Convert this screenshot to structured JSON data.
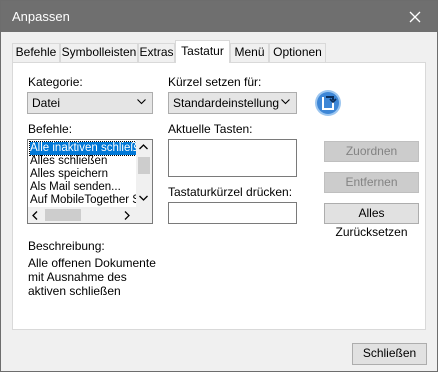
{
  "window": {
    "title": "Anpassen"
  },
  "tabs": [
    {
      "label": "Befehle"
    },
    {
      "label": "Symbolleisten"
    },
    {
      "label": "Extras"
    },
    {
      "label": "Tastatur"
    },
    {
      "label": "Menü"
    },
    {
      "label": "Optionen"
    }
  ],
  "active_tab": "Tastatur",
  "category": {
    "label": "Kategorie:",
    "value": "Datei"
  },
  "shortcut_for": {
    "label": "Kürzel setzen für:",
    "value": "Standardeinstellung"
  },
  "commands": {
    "label": "Befehle:",
    "items": [
      "Alle inaktiven schließen",
      "Alles schließen",
      "Alles speichern",
      "Als Mail senden...",
      "Auf MobileTogether Server"
    ],
    "selected_index": 0
  },
  "current_keys": {
    "label": "Aktuelle Tasten:"
  },
  "press_shortcut": {
    "label": "Tastaturkürzel drücken:"
  },
  "buttons": {
    "assign": "Zuordnen",
    "remove": "Entfernen",
    "reset_all": "Alles Zurücksetzen",
    "close": "Schließen"
  },
  "description": {
    "label": "Beschreibung:",
    "text": "Alle offenen Dokumente mit Ausnahme des aktiven schließen"
  },
  "colors": {
    "titlebar": "#6f6f6f",
    "selection": "#0078d7",
    "reset_icon_blue": "#3d86d6"
  },
  "icons": {
    "close": "close-icon",
    "reset": "reset-toolbar-icon"
  }
}
